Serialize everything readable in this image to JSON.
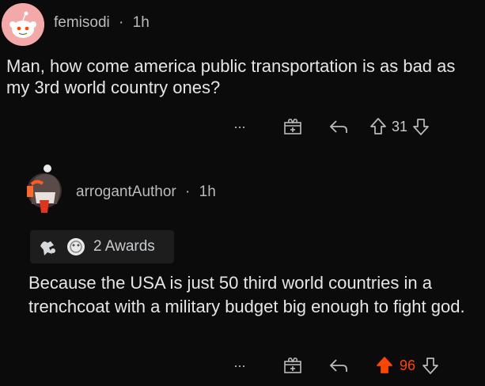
{
  "post": {
    "username": "femisodi",
    "separator": "·",
    "time": "1h",
    "body": "Man, how come america public transportation is as bad as my 3rd world country ones?",
    "actions": {
      "more": "···",
      "upvotes": "31"
    }
  },
  "comment": {
    "username": "arrogantAuthor",
    "separator": "·",
    "time": "1h",
    "awards_label": "2 Awards",
    "body": "Because the USA is just 50 third world countries in a trenchcoat with a military budget big enough to fight god.",
    "actions": {
      "more": "···",
      "upvotes": "96"
    }
  },
  "colors": {
    "background": "#0b0b0b",
    "upvote_active": "#ff4500",
    "avatar_pink": "#f4a9a9"
  },
  "icons": [
    "avatar-icon",
    "more-icon",
    "award-icon",
    "reply-icon",
    "upvote-icon",
    "downvote-icon"
  ]
}
